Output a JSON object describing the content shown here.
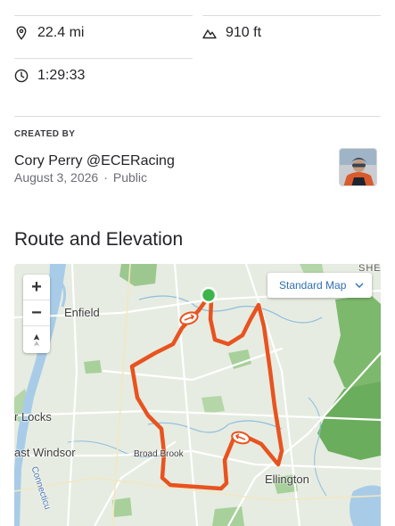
{
  "stats": {
    "distance": "22.4 mi",
    "elevation": "910 ft",
    "time": "1:29:33",
    "icons": {
      "distance": "location-pin-icon",
      "elevation": "mountain-icon",
      "time": "clock-icon"
    }
  },
  "creator": {
    "label": "CREATED BY",
    "name": "Cory Perry @ECERacing",
    "date": "August 3, 2026",
    "separator": "·",
    "visibility": "Public"
  },
  "section": {
    "title": "Route and Elevation"
  },
  "map": {
    "style_button": "Standard Map",
    "zoom_in": "+",
    "zoom_out": "−",
    "labels": {
      "enfield": "Enfield",
      "locks": "r Locks",
      "east_windsor": "ast Windsor",
      "broad_brook": "Broad Brook",
      "ellington": "Ellington",
      "connecticut": "Connecticu",
      "she": "SHE"
    },
    "colors": {
      "route": "#e8531f",
      "start": "#3cb54a",
      "water": "#a8cce8",
      "park": "#5aa35a"
    }
  }
}
